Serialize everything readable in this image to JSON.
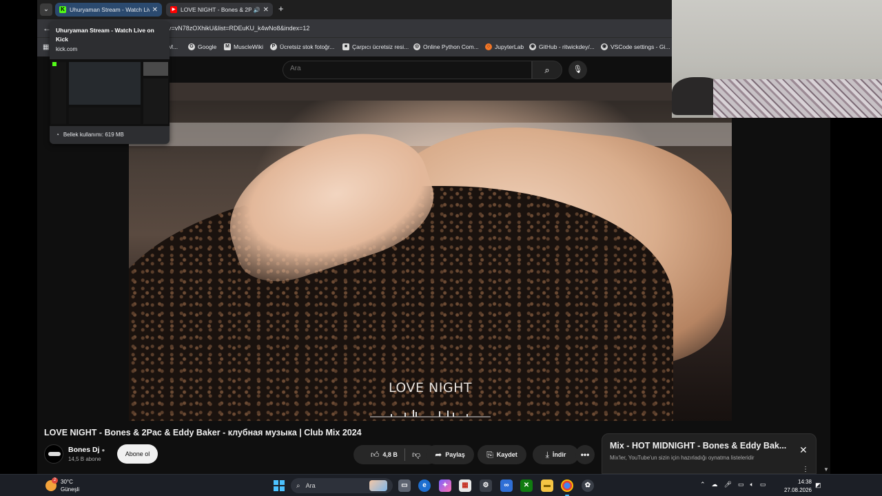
{
  "browser": {
    "tabs": [
      {
        "title": "Uhuryaman Stream - Watch Live on Kick",
        "active": false,
        "hovered": true,
        "favicon": "kick-icon"
      },
      {
        "title": "LOVE NIGHT - Bones & 2Pac & Eddy Baker",
        "active": true,
        "audio": true,
        "favicon": "youtube-icon"
      }
    ],
    "url": "v=vN78zOXhikU&list=RDEuKU_k4wNo8&index=12",
    "bookmarks": [
      {
        "label": "M...",
        "icon": "bookmark-icon"
      },
      {
        "label": "Google",
        "icon": "google-icon"
      },
      {
        "label": "MuscleWiki",
        "icon": "musclewiki-icon"
      },
      {
        "label": "Ücretsiz stok fotoğr...",
        "icon": "pexels-icon"
      },
      {
        "label": "Çarpıcı ücretsiz resi...",
        "icon": "unsplash-icon"
      },
      {
        "label": "Online Python Com...",
        "icon": "globe-icon"
      },
      {
        "label": "JupyterLab",
        "icon": "jupyter-icon"
      },
      {
        "label": "GitHub - ritwickdey/...",
        "icon": "github-icon"
      },
      {
        "label": "VSCode settings - Gi...",
        "icon": "github-icon"
      }
    ]
  },
  "tab_hover_card": {
    "title": "Uhuryaman Stream - Watch Live on Kick",
    "domain": "kick.com",
    "memory": "Bellek kullanımı: 619 MB"
  },
  "youtube": {
    "search_placeholder": "Ara",
    "video_caption": "LOVE NIGHT",
    "video_title": "LOVE NIGHT - Bones & 2Pac & Eddy Baker - клубная музыка | Club Mix 2024",
    "channel": {
      "name": "Bones Dj",
      "subscribers": "14,5 B abone",
      "subscribe_label": "Abone ol"
    },
    "actions": {
      "likes": "4,8 B",
      "share": "Paylaş",
      "save": "Kaydet",
      "download": "İndir"
    },
    "mix": {
      "title": "Mix - HOT MIDNIGHT - Bones & Eddy Bak...",
      "subtitle": "Mix'ler, YouTube'un sizin için hazırladığı oynatma listeleridir"
    }
  },
  "taskbar": {
    "weather_temp": "30°C",
    "weather_desc": "Güneşli",
    "search_label": "Ara",
    "time": "14:38",
    "date": "27.08.2026"
  },
  "colors": {
    "youtube_bg": "#0f0f0f",
    "accent_blue": "#4cc2ff",
    "kick_green": "#53fc18",
    "youtube_red": "#ff0000"
  }
}
